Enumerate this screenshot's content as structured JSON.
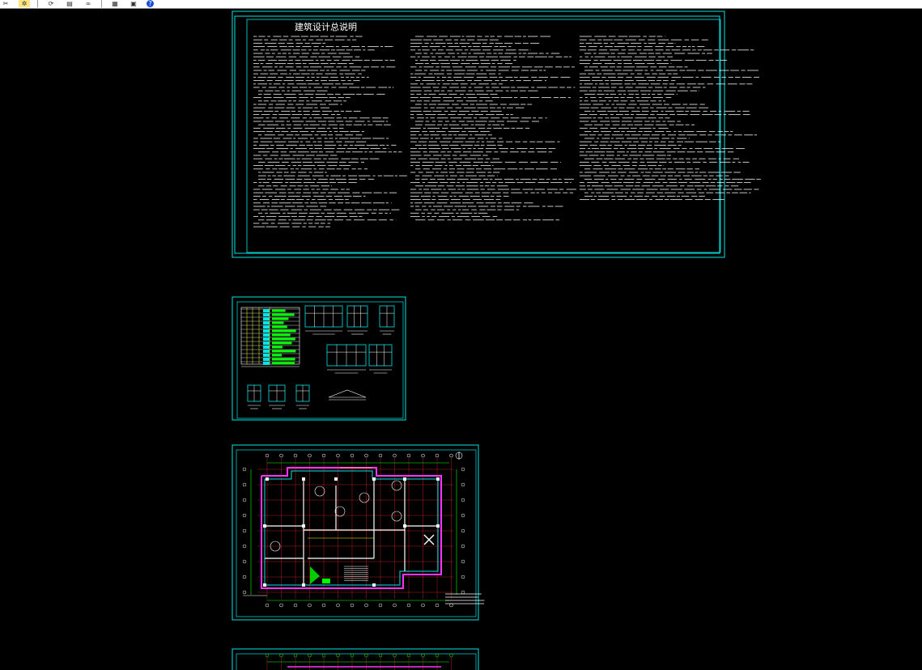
{
  "toolbar": {
    "buttons": [
      {
        "name": "cut-icon",
        "glyph": "✂"
      },
      {
        "name": "sparkle-tool-icon",
        "glyph": "✲"
      },
      {
        "name": "refresh-icon",
        "glyph": "⟳"
      },
      {
        "name": "print-icon",
        "glyph": "▤"
      },
      {
        "name": "binoculars-icon",
        "glyph": "∞"
      },
      {
        "name": "layers-icon",
        "glyph": "▦"
      },
      {
        "name": "toolbox-icon",
        "glyph": "▣"
      },
      {
        "name": "help-icon",
        "glyph": "?"
      }
    ]
  },
  "drawing": {
    "sheet1": {
      "title": "建筑设计总说明"
    }
  },
  "colors": {
    "frame": "#00e5e5",
    "text": "#ffffff",
    "wall": "#ff2a2a",
    "green": "#00ff00",
    "magenta": "#ff33ff",
    "yellow": "#ffff00",
    "blue": "#4a6cff"
  }
}
